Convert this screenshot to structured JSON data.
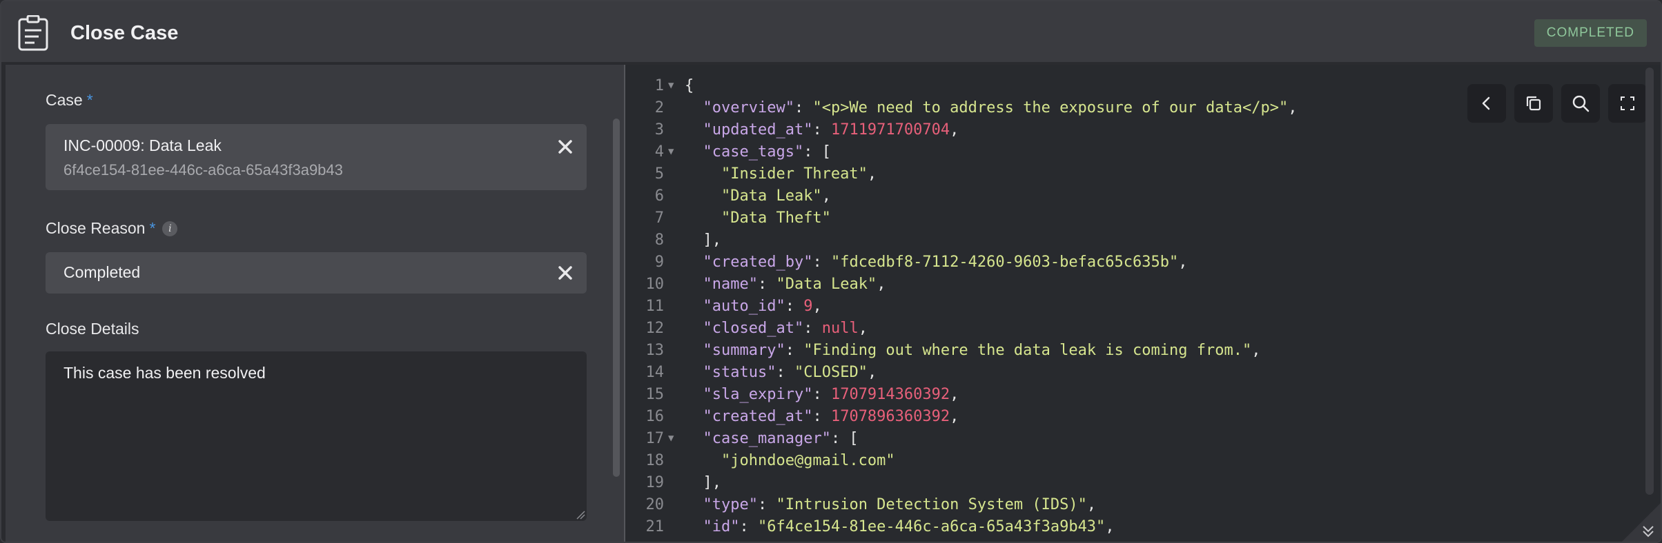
{
  "header": {
    "title": "Close Case",
    "status": "COMPLETED"
  },
  "form": {
    "case_label": "Case",
    "case_required": "*",
    "case_value": "INC-00009: Data Leak",
    "case_id": "6f4ce154-81ee-446c-a6ca-65a43f3a9b43",
    "reason_label": "Close Reason",
    "reason_required": "*",
    "reason_value": "Completed",
    "details_label": "Close Details",
    "details_value": "This case has been resolved"
  },
  "editor": {
    "lines": [
      {
        "n": "1",
        "fold": true
      },
      {
        "n": "2"
      },
      {
        "n": "3"
      },
      {
        "n": "4",
        "fold": true
      },
      {
        "n": "5"
      },
      {
        "n": "6"
      },
      {
        "n": "7"
      },
      {
        "n": "8"
      },
      {
        "n": "9"
      },
      {
        "n": "10"
      },
      {
        "n": "11"
      },
      {
        "n": "12"
      },
      {
        "n": "13"
      },
      {
        "n": "14"
      },
      {
        "n": "15"
      },
      {
        "n": "16"
      },
      {
        "n": "17",
        "fold": true
      },
      {
        "n": "18"
      },
      {
        "n": "19"
      },
      {
        "n": "20"
      },
      {
        "n": "21"
      }
    ],
    "tokens": {
      "l1": "{",
      "k_overview": "\"overview\"",
      "v_overview": "\"<p>We need to address the exposure of our data</p>\"",
      "k_updated": "\"updated_at\"",
      "v_updated": "1711971700704",
      "k_tags": "\"case_tags\"",
      "t1": "\"Insider Threat\"",
      "t2": "\"Data Leak\"",
      "t3": "\"Data Theft\"",
      "k_created_by": "\"created_by\"",
      "v_created_by": "\"fdcedbf8-7112-4260-9603-befac65c635b\"",
      "k_name": "\"name\"",
      "v_name": "\"Data Leak\"",
      "k_auto": "\"auto_id\"",
      "v_auto": "9",
      "k_closed": "\"closed_at\"",
      "v_closed": "null",
      "k_summary": "\"summary\"",
      "v_summary": "\"Finding out where the data leak is coming from.\"",
      "k_status": "\"status\"",
      "v_status": "\"CLOSED\"",
      "k_sla": "\"sla_expiry\"",
      "v_sla": "1707914360392",
      "k_created_at": "\"created_at\"",
      "v_created_at": "1707896360392",
      "k_manager": "\"case_manager\"",
      "v_manager": "\"johndoe@gmail.com\"",
      "k_type": "\"type\"",
      "v_type": "\"Intrusion Detection System (IDS)\"",
      "k_id": "\"id\"",
      "v_id": "\"6f4ce154-81ee-446c-a6ca-65a43f3a9b43\""
    }
  },
  "icons": {
    "header": "clipboard-icon",
    "clear": "close-icon",
    "info": "info-icon",
    "back": "chevron-left-icon",
    "copy": "copy-icon",
    "search": "search-icon",
    "fullscreen": "fullscreen-icon",
    "corner": "double-chevron-down-icon"
  }
}
